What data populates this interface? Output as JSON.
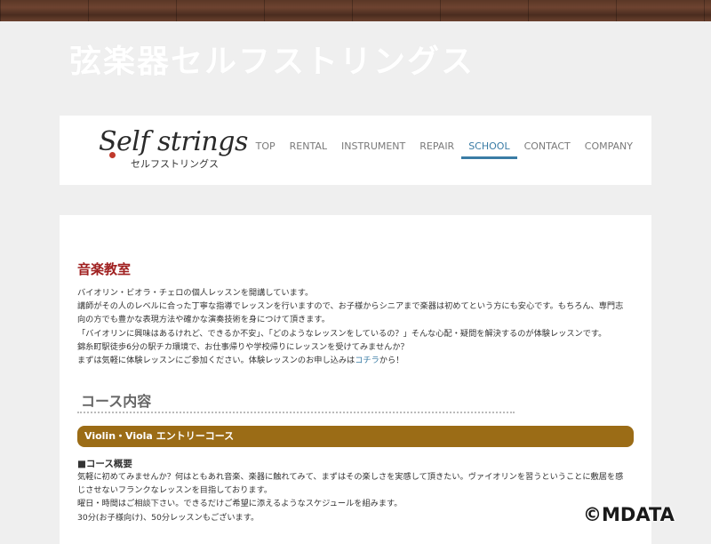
{
  "site": {
    "title": "弦楽器セルフストリングス",
    "logo_main": "Self strings",
    "logo_sub": "セルフストリングス"
  },
  "nav": {
    "items": [
      {
        "label": "TOP",
        "active": false
      },
      {
        "label": "RENTAL",
        "active": false
      },
      {
        "label": "INSTRUMENT",
        "active": false
      },
      {
        "label": "REPAIR",
        "active": false
      },
      {
        "label": "SCHOOL",
        "active": true
      },
      {
        "label": "CONTACT",
        "active": false
      },
      {
        "label": "COMPANY",
        "active": false
      }
    ]
  },
  "content": {
    "section_title": "音楽教室",
    "intro_lines": [
      "バイオリン・ビオラ・チェロの個人レッスンを開講しています。",
      "講師がその人のレベルに合った丁寧な指導でレッスンを行いますので、お子様からシニアまで楽器は初めてという方にも安心です。もちろん、専門志",
      "向の方でも豊かな表現方法や確かな演奏技術を身につけて頂きます。",
      "「バイオリンに興味はあるけれど、できるか不安」、「どのようなレッスンをしているの？」そんな心配・疑問を解決するのが体験レッスンです。",
      "錦糸町駅徒歩6分の駅チカ環境で、お仕事帰りや学校帰りにレッスンを受けてみませんか？"
    ],
    "last_line_prefix": "まずは気軽に体験レッスンにご参加ください。体験レッスンのお申し込みは",
    "last_line_link": "コチラ",
    "last_line_suffix": "から！",
    "course_heading": "コース内容",
    "course_band": "Violin・Viola エントリーコース",
    "course_sub": "■コース概要",
    "course_desc": [
      "気軽に初めてみませんか？何はともあれ音楽、楽器に触れてみて、まずはその楽しさを実感して頂きたい。ヴァイオリンを習うということに敷居を感",
      "じさせないフランクなレッスンを目指しております。",
      "曜日・時間はご相談下さい。できるだけご希望に添えるようなスケジュールを組みます。",
      "30分(お子様向け)、50分レッスンもございます。"
    ]
  },
  "watermark": "©MDATA",
  "colors": {
    "accent": "#3a7ca5",
    "section_red": "#a02020",
    "band": "#9b6c16"
  }
}
